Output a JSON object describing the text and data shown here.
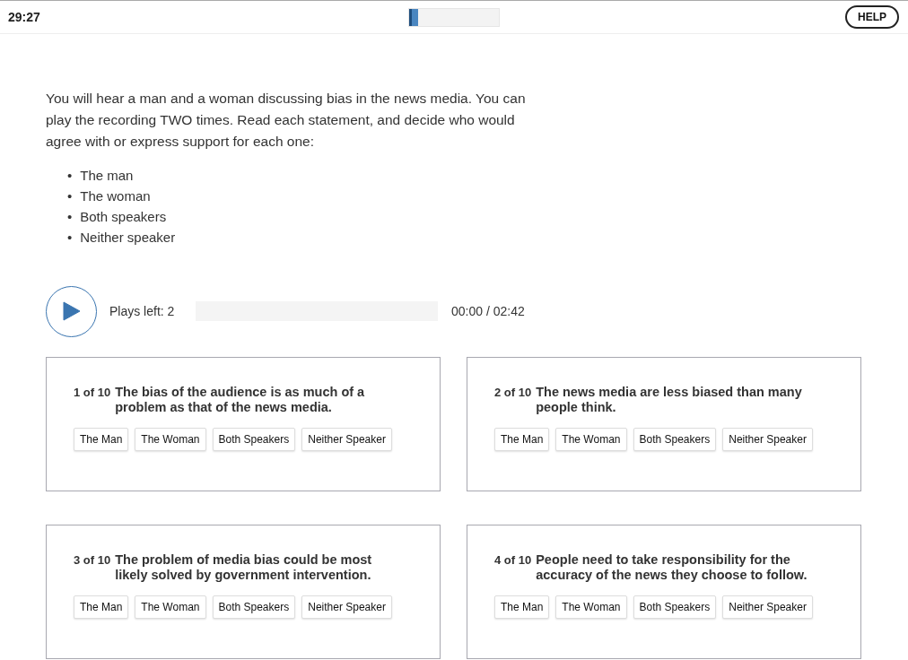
{
  "header": {
    "timer": "29:27",
    "progress": {
      "level": 0.1
    },
    "help_button": "HELP"
  },
  "instructions": "You will hear a man and a woman discussing bias in the news media. You can play the recording TWO times. Read each statement, and decide who would agree with or express support for each one:",
  "bullets": [
    {
      "marker": "•",
      "text": "The man"
    },
    {
      "marker": "•",
      "text": "The woman"
    },
    {
      "marker": "•",
      "text": "Both speakers"
    },
    {
      "marker": "•",
      "text": "Neither speaker"
    }
  ],
  "player": {
    "plays_left": "Plays left: 2",
    "time": "00:00 / 02:42"
  },
  "questions": [
    {
      "number": "1 of 10",
      "statement": "The bias of the audience is as much of a problem as that of the news media.",
      "options": [
        {
          "label": "The Man",
          "selected": false
        },
        {
          "label": "The Woman",
          "selected": false
        },
        {
          "label": "Both Speakers",
          "selected": false
        },
        {
          "label": "Neither Speaker",
          "selected": false
        }
      ]
    },
    {
      "number": "2 of 10",
      "statement": "The news media are less biased than many people think.",
      "options": [
        {
          "label": "The Man",
          "selected": false
        },
        {
          "label": "The Woman",
          "selected": false
        },
        {
          "label": "Both Speakers",
          "selected": false
        },
        {
          "label": "Neither Speaker",
          "selected": false
        }
      ]
    },
    {
      "number": "3 of 10",
      "statement": "The problem of media bias could be most likely solved by government intervention.",
      "options": [
        {
          "label": "The Man",
          "selected": false
        },
        {
          "label": "The Woman",
          "selected": false
        },
        {
          "label": "Both Speakers",
          "selected": false
        },
        {
          "label": "Neither Speaker",
          "selected": false
        }
      ]
    },
    {
      "number": "4 of 10",
      "statement": "People need to take responsibility for the accuracy of the news they choose to follow.",
      "options": [
        {
          "label": "The Man",
          "selected": false
        },
        {
          "label": "The Woman",
          "selected": false
        },
        {
          "label": "Both Speakers",
          "selected": false
        },
        {
          "label": "Neither Speaker",
          "selected": false
        }
      ]
    }
  ]
}
